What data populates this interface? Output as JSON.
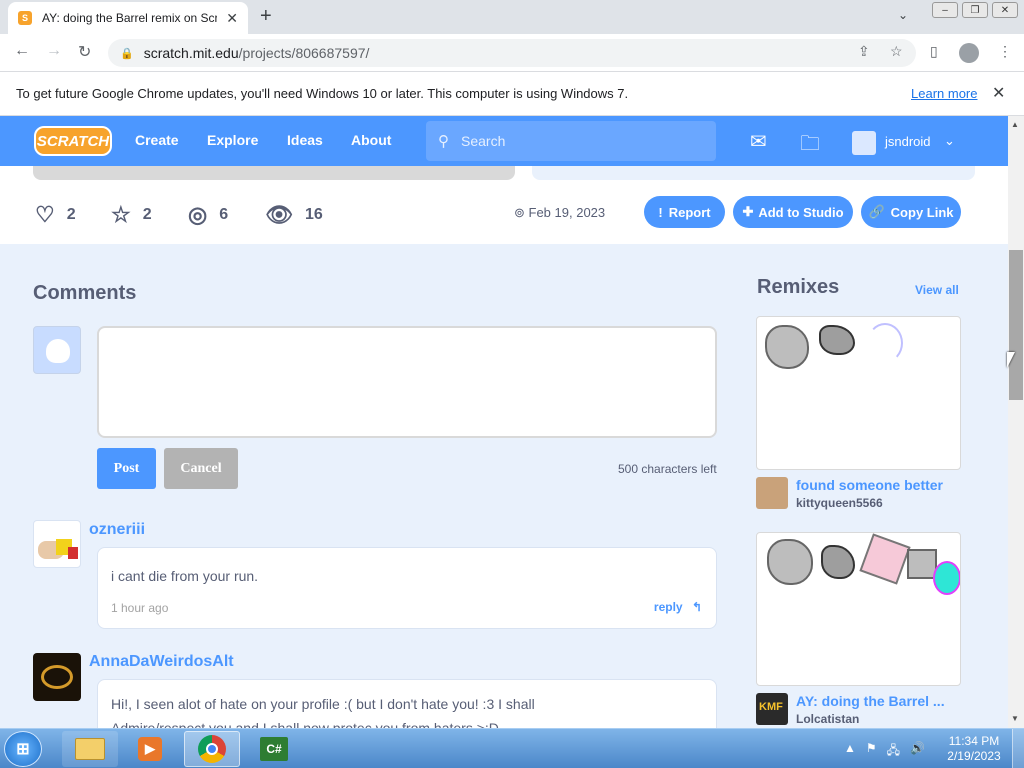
{
  "browser": {
    "tab_title": "AY: doing the Barrel remix on Scratch",
    "url_domain": "scratch.mit.edu",
    "url_path": "/projects/806687597/",
    "infobar_message": "To get future Google Chrome updates, you'll need Windows 10 or later. This computer is using Windows 7.",
    "infobar_link": "Learn more"
  },
  "nav": {
    "logo": "SCRATCH",
    "links": [
      "Create",
      "Explore",
      "Ideas",
      "About"
    ],
    "search_placeholder": "Search",
    "username": "jsndroid"
  },
  "stats": {
    "loves": "2",
    "favorites": "2",
    "remixes": "6",
    "views": "16",
    "date": "Feb 19, 2023",
    "report": "Report",
    "add_to_studio": "Add to Studio",
    "copy_link": "Copy Link"
  },
  "comments": {
    "heading": "Comments",
    "post": "Post",
    "cancel": "Cancel",
    "chars_left": "500 characters left",
    "items": [
      {
        "user": "ozneriii",
        "text": "i cant die from your run.",
        "time": "1 hour ago",
        "reply": "reply"
      },
      {
        "user": "AnnaDaWeirdosAlt",
        "text": "Hi!, I seen alot of hate on your profile :( but I don't hate you! :3 I shall",
        "text2": "Admire/respect you and I shall now protec you from haters >:D"
      }
    ]
  },
  "remixes": {
    "heading": "Remixes",
    "view_all": "View all",
    "items": [
      {
        "title": "found someone better",
        "user": "kittyqueen5566"
      },
      {
        "title": "AY: doing the Barrel ...",
        "user": "Lolcatistan"
      }
    ]
  },
  "taskbar": {
    "time": "11:34 PM",
    "date": "2/19/2023"
  },
  "colors": {
    "scratch_blue": "#4c97ff",
    "scratch_orange": "#f7a32c",
    "text_gray": "#575e75"
  }
}
